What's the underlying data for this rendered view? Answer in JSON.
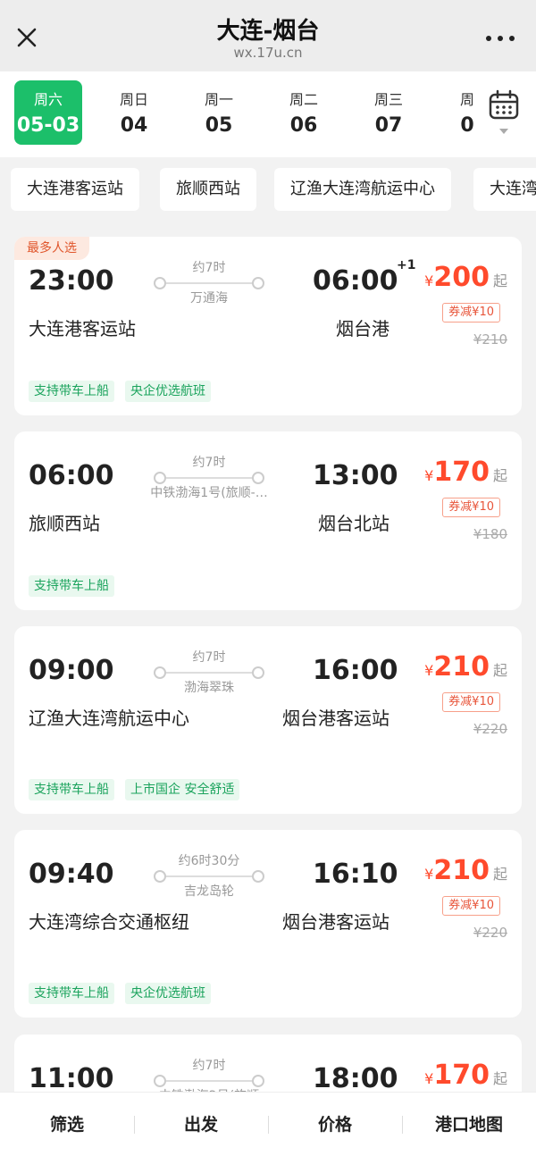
{
  "header": {
    "title": "大连-烟台",
    "url": "wx.17u.cn"
  },
  "dates": [
    {
      "weekday": "周六",
      "date": "05-03",
      "active": true
    },
    {
      "weekday": "周日",
      "date": "04"
    },
    {
      "weekday": "周一",
      "date": "05"
    },
    {
      "weekday": "周二",
      "date": "06"
    },
    {
      "weekday": "周三",
      "date": "07"
    },
    {
      "weekday": "周",
      "date": "0"
    }
  ],
  "stations": [
    "大连港客运站",
    "旅顺西站",
    "辽渔大连湾航运中心",
    "大连湾"
  ],
  "currency": "¥",
  "price_suffix": "起",
  "trips": [
    {
      "badge": "最多人选",
      "dep_time": "23:00",
      "arr_time": "06:00",
      "next_day": "+1",
      "duration": "约7时",
      "ship": "万通海",
      "dep_station": "大连港客运站",
      "arr_station": "烟台港",
      "price": "200",
      "coupon": "券减¥10",
      "orig_price": "¥210",
      "tags": [
        "支持带车上船",
        "央企优选航班"
      ]
    },
    {
      "dep_time": "06:00",
      "arr_time": "13:00",
      "duration": "约7时",
      "ship": "中铁渤海1号(旅顺-…",
      "dep_station": "旅顺西站",
      "arr_station": "烟台北站",
      "price": "170",
      "coupon": "券减¥10",
      "orig_price": "¥180",
      "tags": [
        "支持带车上船"
      ]
    },
    {
      "dep_time": "09:00",
      "arr_time": "16:00",
      "duration": "约7时",
      "ship": "渤海翠珠",
      "dep_station": "辽渔大连湾航运中心",
      "arr_station": "烟台港客运站",
      "price": "210",
      "coupon": "券减¥10",
      "orig_price": "¥220",
      "tags": [
        "支持带车上船",
        "上市国企 安全舒适"
      ]
    },
    {
      "dep_time": "09:40",
      "arr_time": "16:10",
      "duration": "约6时30分",
      "ship": "吉龙岛轮",
      "dep_station": "大连湾综合交通枢纽",
      "arr_station": "烟台港客运站",
      "price": "210",
      "coupon": "券减¥10",
      "orig_price": "¥220",
      "tags": [
        "支持带车上船",
        "央企优选航班"
      ]
    },
    {
      "dep_time": "11:00",
      "arr_time": "18:00",
      "duration": "约7时",
      "ship": "中铁渤海2号(旅顺",
      "price": "170"
    }
  ],
  "bottom_nav": [
    "筛选",
    "出发",
    "价格",
    "港口地图"
  ],
  "colors": {
    "accent_green": "#1cbf6a",
    "price_red": "#ff4a2c",
    "tag_green": "#1aa35c"
  }
}
